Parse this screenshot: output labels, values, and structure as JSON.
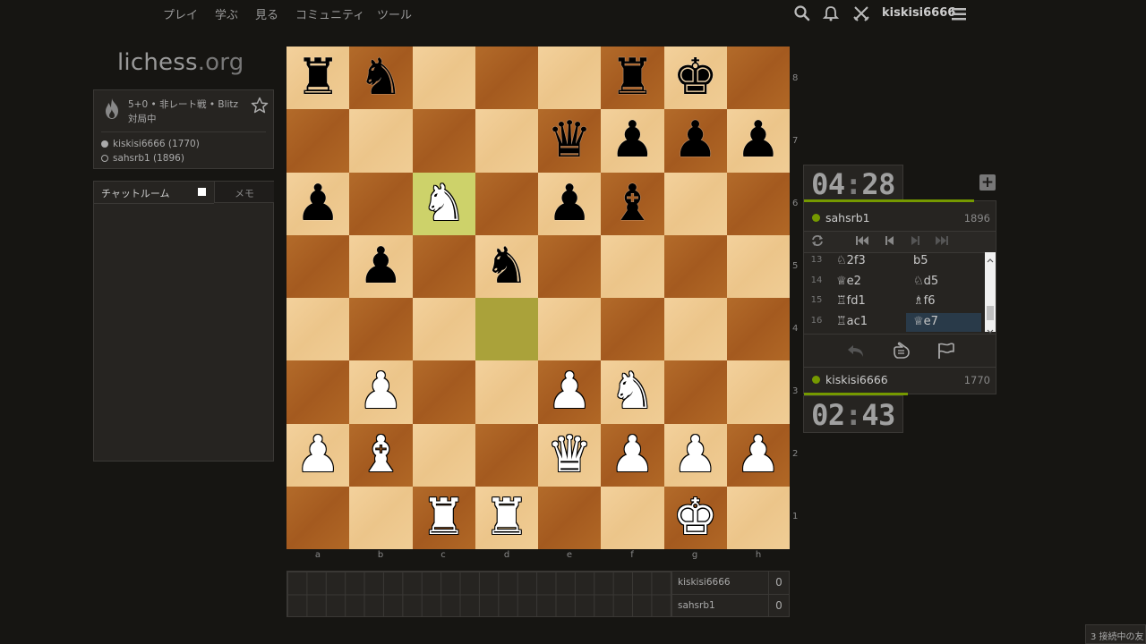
{
  "nav": {
    "items": [
      "プレイ",
      "学ぶ",
      "見る",
      "コミュニティ",
      "ツール"
    ],
    "username": "kiskisi6666",
    "icons": [
      "search-icon",
      "bell-icon",
      "swords-icon",
      "hamburger-menu-icon"
    ]
  },
  "logo": {
    "main": "lichess",
    "suffix": ".org"
  },
  "game_info": {
    "title": "5+0 • 非レート戦 • Blitz",
    "status": "対局中",
    "players": [
      {
        "label": "kiskisi6666 (1770)",
        "color": "white"
      },
      {
        "label": "sahsrb1 (1896)",
        "color": "black"
      }
    ]
  },
  "chat": {
    "tab_chat": "チャットルーム",
    "tab_memo": "メモ"
  },
  "board": {
    "position": [
      [
        "br",
        "bn",
        "",
        "",
        "",
        "br",
        "bk",
        ""
      ],
      [
        "",
        "",
        "",
        "",
        "bq",
        "bp",
        "bp",
        "bp"
      ],
      [
        "bp",
        "",
        "wn",
        "",
        "bp",
        "bb",
        "",
        ""
      ],
      [
        "",
        "bp",
        "",
        "bn",
        "",
        "",
        "",
        ""
      ],
      [
        "",
        "",
        "",
        "",
        "",
        "",
        "",
        ""
      ],
      [
        "",
        "wp",
        "",
        "",
        "wp",
        "wn",
        "",
        ""
      ],
      [
        "wp",
        "wb",
        "",
        "",
        "wq",
        "wp",
        "wp",
        "wp"
      ],
      [
        "",
        "",
        "wr",
        "wr",
        "",
        "",
        "wk",
        ""
      ]
    ],
    "highlight": [
      "c6",
      "d4"
    ],
    "ranks": [
      "8",
      "7",
      "6",
      "5",
      "4",
      "3",
      "2",
      "1"
    ],
    "files": [
      "a",
      "b",
      "c",
      "d",
      "e",
      "f",
      "g",
      "h"
    ]
  },
  "crosstable": [
    {
      "name": "kiskisi6666",
      "score": "0"
    },
    {
      "name": "sahsrb1",
      "score": "0"
    }
  ],
  "clocks": {
    "top": {
      "min": "04",
      "sec": "28"
    },
    "bottom": {
      "min": "02",
      "sec": "43"
    }
  },
  "top_player": {
    "name": "sahsrb1",
    "rating": "1896",
    "clock_bar_fraction": 0.89
  },
  "bottom_player": {
    "name": "kiskisi6666",
    "rating": "1770",
    "clock_bar_fraction": 0.54
  },
  "moves": [
    {
      "num": "13",
      "white": "♘2f3",
      "black": "b5"
    },
    {
      "num": "14",
      "white": "♕e2",
      "black": "♘d5"
    },
    {
      "num": "15",
      "white": "♖fd1",
      "black": "♗f6"
    },
    {
      "num": "16",
      "white": "♖ac1",
      "black": "♕e7"
    }
  ],
  "current_move_index": 3,
  "watchers": "3 接続中の友"
}
